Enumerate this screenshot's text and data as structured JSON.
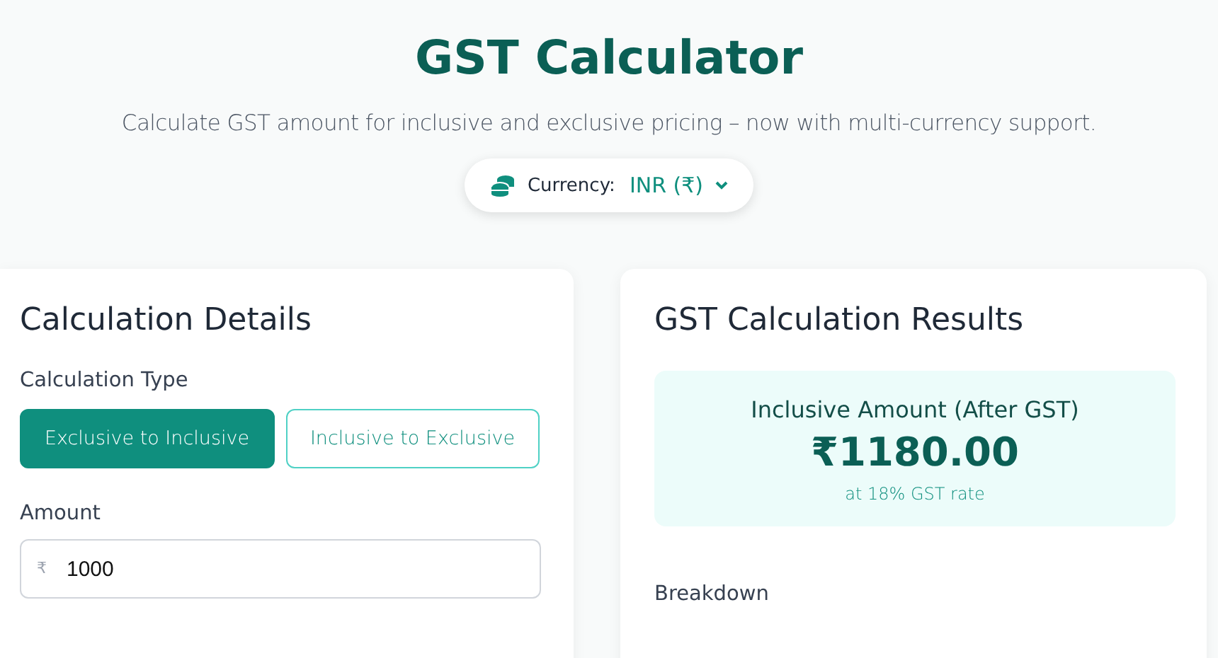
{
  "header": {
    "title": "GST Calculator",
    "subtitle": "Calculate GST amount for inclusive and exclusive pricing – now with multi-currency support."
  },
  "currency": {
    "label": "Currency:",
    "value": "INR (₹)"
  },
  "details": {
    "title": "Calculation Details",
    "type_label": "Calculation Type",
    "types": [
      {
        "label": "Exclusive to Inclusive",
        "selected": true
      },
      {
        "label": "Inclusive to Exclusive",
        "selected": false
      }
    ],
    "amount_label": "Amount",
    "amount_symbol": "₹",
    "amount_value": "1000"
  },
  "results": {
    "title": "GST Calculation Results",
    "result_label": "Inclusive Amount (After GST)",
    "result_value": "₹1180.00",
    "result_note": "at 18% GST rate",
    "breakdown_title": "Breakdown"
  }
}
